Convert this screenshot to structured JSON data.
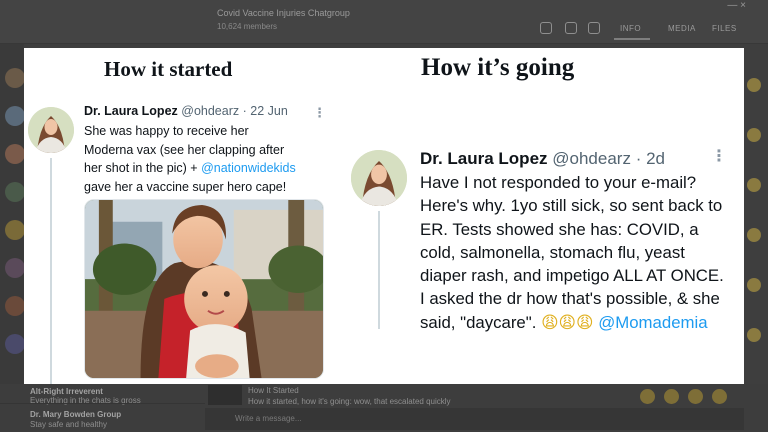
{
  "background_app": {
    "chat_title": "Covid Vaccine Injuries Chatgroup",
    "chat_subtitle": "10,624 members",
    "window_controls": "—  ×",
    "tabs": [
      "INFO",
      "MEDIA",
      "FILES"
    ],
    "footer_chats": [
      {
        "name": "Alt-Right Irreverent",
        "preview": "Everything in the chats is gross"
      },
      {
        "name": "Dr. Mary Bowden Group",
        "preview": "Stay safe and healthy"
      }
    ],
    "footer_post_title": "How It Started",
    "footer_post_text": "How it started, how it's going: wow, that escalated quickly",
    "input_placeholder": "Write a message..."
  },
  "meme": {
    "left_heading": "How it started",
    "right_heading": "How it’s going",
    "tweet_before": {
      "author_name": "Dr. Laura Lopez",
      "handle": "@ohdearz",
      "separator": " · ",
      "date": "22 Jun",
      "text_part1": "She was happy to receive her Moderna vax (see her clapping after her shot in the pic) + ",
      "mention": "@nationwidekids",
      "text_part2": " gave her a vaccine super hero cape!"
    },
    "tweet_after": {
      "author_name": "Dr. Laura Lopez",
      "handle": "@ohdearz",
      "separator": " · ",
      "date": "2d",
      "text": "Have I not responded to your e-mail? Here's why. 1yo still sick, so sent back to ER. Tests showed she has: COVID, a cold, salmonella, stomach flu, yeast diaper rash, and impetigo ALL AT ONCE. I asked the dr how that's possible, & she said, \"daycare\". ",
      "emojis": "😩😩😩",
      "mention": " @Momademia"
    }
  }
}
